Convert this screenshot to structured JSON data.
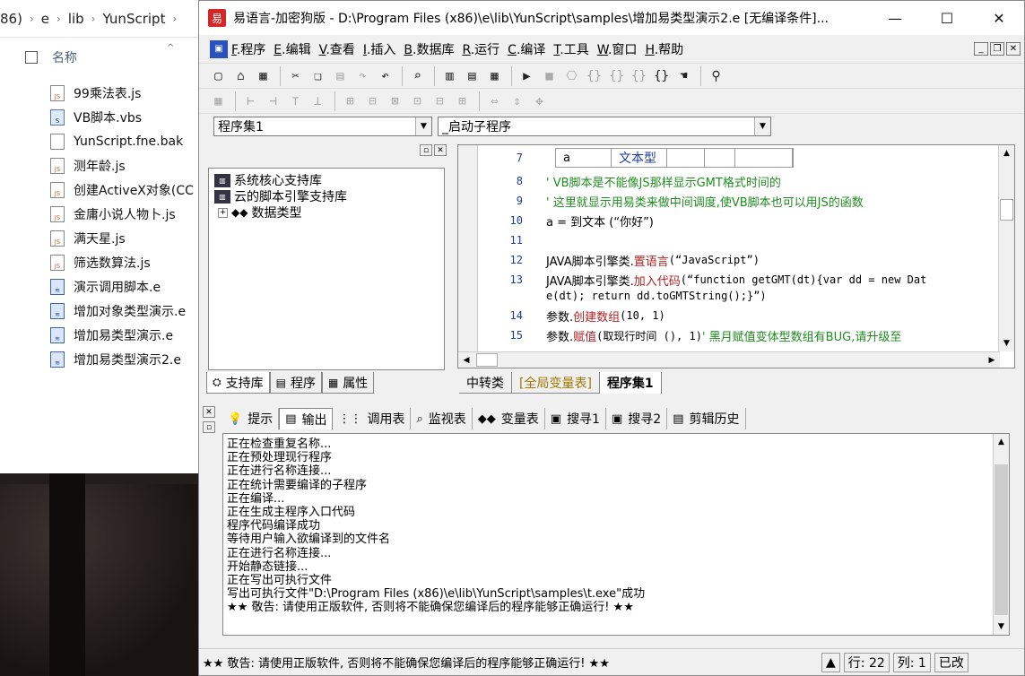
{
  "explorer": {
    "breadcrumb": [
      "86)",
      "e",
      "lib",
      "YunScript"
    ],
    "column_name": "名称",
    "files": [
      {
        "name": "99乘法表.js",
        "icon": "js-file-icon"
      },
      {
        "name": "VB脚本.vbs",
        "icon": "vbs-file-icon"
      },
      {
        "name": "YunScript.fne.bak",
        "icon": "file-icon"
      },
      {
        "name": "测年龄.js",
        "icon": "js-file-icon"
      },
      {
        "name": "创建ActiveX对象(CC",
        "icon": "js-file-icon"
      },
      {
        "name": "金庸小说人物卜.js",
        "icon": "js-file-icon"
      },
      {
        "name": "满天星.js",
        "icon": "js-file-icon"
      },
      {
        "name": "筛选数算法.js",
        "icon": "js-file-icon"
      },
      {
        "name": "演示调用脚本.e",
        "icon": "e-file-icon"
      },
      {
        "name": "增加对象类型演示.e",
        "icon": "e-file-icon"
      },
      {
        "name": "增加易类型演示.e",
        "icon": "e-file-icon"
      },
      {
        "name": "增加易类型演示2.e",
        "icon": "e-file-icon"
      }
    ]
  },
  "window": {
    "title": "易语言-加密狗版 - D:\\Program Files (x86)\\e\\lib\\YunScript\\samples\\增加易类型演示2.e [无编译条件]...",
    "app_icon": "易"
  },
  "menu": [
    {
      "key": "F",
      "label": ".程序"
    },
    {
      "key": "E",
      "label": ".编辑"
    },
    {
      "key": "V",
      "label": ".查看"
    },
    {
      "key": "I",
      "label": ".插入"
    },
    {
      "key": "B",
      "label": ".数据库"
    },
    {
      "key": "R",
      "label": ".运行"
    },
    {
      "key": "C",
      "label": ".编译"
    },
    {
      "key": "T",
      "label": ".工具"
    },
    {
      "key": "W",
      "label": ".窗口"
    },
    {
      "key": "H",
      "label": ".帮助"
    }
  ],
  "combos": {
    "left": "程序集1",
    "right": "_启动子程序"
  },
  "left_panel": {
    "tree": [
      {
        "label": "系统核心支持库",
        "icon": "library-icon"
      },
      {
        "label": "云的脚本引擎支持库",
        "icon": "library-icon"
      },
      {
        "label": "数据类型",
        "icon": "datatype-icon",
        "expandable": true
      }
    ],
    "tabs": [
      "支持库",
      "程序",
      "属性"
    ]
  },
  "editor": {
    "var_row": {
      "line": "7",
      "name": "a",
      "type": "文本型"
    },
    "lines": [
      {
        "n": "8",
        "text": "' VB脚本是不能像JS那样显示GMT格式时间的",
        "kind": "comment"
      },
      {
        "n": "9",
        "text": "' 这里就显示用易类来做中间调度,使VB脚本也可以用JS的函数",
        "kind": "comment"
      },
      {
        "n": "10",
        "text": "a = 到文本 (“你好”)",
        "kind": "code"
      },
      {
        "n": "11",
        "text": "",
        "kind": "code"
      },
      {
        "n": "12",
        "obj": "JAVA脚本引擎类.",
        "method": "置语言",
        "args": " (“JavaScript”)",
        "kind": "call"
      },
      {
        "n": "13",
        "obj": "JAVA脚本引擎类.",
        "method": "加入代码",
        "args": " (“function getGMT(dt){var dd = new Dat",
        "cont": "e(dt); return dd.toGMTString();}”)",
        "kind": "call2"
      },
      {
        "n": "14",
        "obj": "参数.",
        "method": "创建数组",
        "args": " (10, 1)",
        "kind": "call"
      },
      {
        "n": "15",
        "obj": "参数.",
        "method": "赋值",
        "args": " (取现行时间 (), 1)",
        "comment": " ' 黑月赋值变体型数组有BUG,请升级至",
        "kind": "call3"
      }
    ],
    "tabs": [
      "中转类",
      "[全局变量表]",
      "程序集1"
    ]
  },
  "bottom": {
    "tabs": [
      "提示",
      "输出",
      "调用表",
      "监视表",
      "变量表",
      "搜寻1",
      "搜寻2",
      "剪辑历史"
    ],
    "output": [
      "正在检查重复名称...",
      "正在预处理现行程序",
      "正在进行名称连接...",
      "正在统计需要编译的子程序",
      "正在编译...",
      "正在生成主程序入口代码",
      "程序代码编译成功",
      "等待用户输入欲编译到的文件名",
      "正在进行名称连接...",
      "开始静态链接...",
      "正在写出可执行文件",
      "写出可执行文件\"D:\\Program Files (x86)\\e\\lib\\YunScript\\samples\\t.exe\"成功",
      "★★ 敬告: 请使用正版软件, 否则将不能确保您编译后的程序能够正确运行! ★★"
    ]
  },
  "status": {
    "message": "★★ 敬告: 请使用正版软件, 否则将不能确保您编译后的程序能够正确运行! ★★",
    "row_label": "行: 22",
    "col_label": "列: 1",
    "mode": "已改"
  }
}
